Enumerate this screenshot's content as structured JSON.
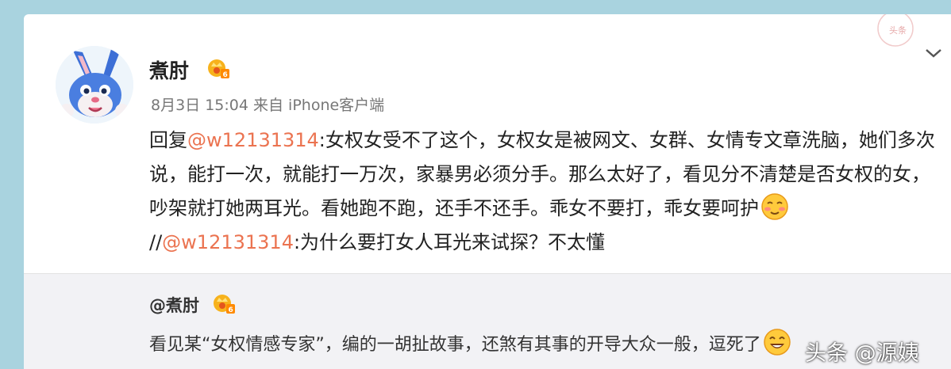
{
  "post": {
    "username": "煮肘",
    "timestamp": "8月3日 15:04 来自 iPhone客户端",
    "reply_prefix": "回复",
    "mention_1": "@w12131314",
    "reply_text_1": ":女权女受不了这个，女权女是被网文、女群、女情专文章洗脑，她们多次说，能打一次，就能打一万次，家暴男必须分手。那么太好了，看见分不清楚是否女权的女，吵架就打她两耳光。看她跑不跑，还手不还手。乖女不要打，乖女要呵护",
    "separator": "//",
    "mention_2": "@w12131314",
    "reply_text_2": ":为什么要打女人耳光来试探？不太懂"
  },
  "quoted": {
    "username": "@煮肘",
    "text": "看见某“女权情感专家”，编的一胡扯故事，还煞有其事的开导大众一般，逗死了"
  },
  "watermark": "头条 @源姨",
  "stamp_text": "头条",
  "icons": [
    "avatar-rabbit",
    "vip-badge-icon",
    "chevron-down-icon",
    "blush-emoji-icon",
    "laugh-emoji-icon",
    "toutiao-stamp"
  ],
  "colors": {
    "mention": "#eb7350",
    "background": "#a9d3df",
    "quote_bg": "#f2f2f5"
  }
}
